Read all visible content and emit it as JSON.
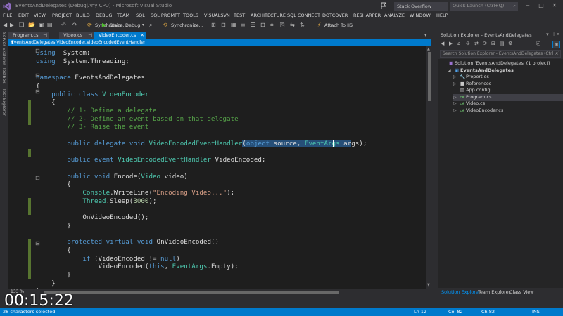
{
  "window": {
    "title": "EventsAndDelegates (Debug|Any CPU) - Microsoft Visual Studio",
    "search_stack_overflow": "Stack Overflow",
    "quick_launch": "Quick Launch (Ctrl+Q)",
    "minimize": "‒",
    "maximize": "□",
    "close": "✕"
  },
  "menu": [
    "FILE",
    "EDIT",
    "VIEW",
    "PROJECT",
    "BUILD",
    "DEBUG",
    "TEAM",
    "SQL",
    "SQL PROMPT",
    "TOOLS",
    "VISUALSVN",
    "TEST",
    "ARCHITECTURE",
    "SQL CONNECT",
    "DOTCOVER",
    "RESHARPER",
    "ANALYZE",
    "WINDOW",
    "HELP"
  ],
  "toolbar": {
    "synchronize": "Synchronize...",
    "start": "Start",
    "config": "Debug",
    "attach": "Attach To IIS"
  },
  "side_tabs": [
    "Server Explorer",
    "Toolbox",
    "Test Explorer"
  ],
  "doc_tabs": [
    {
      "label": "Program.cs",
      "active": false
    },
    {
      "label": "Video.cs",
      "active": false
    },
    {
      "label": "VideoEncoder.cs",
      "active": true
    }
  ],
  "navbar": "EventsAndDelegates.VideoEncoder.VideoEncodedEventHandler",
  "editor": {
    "zoom": "133 %"
  },
  "solution_explorer": {
    "title": "Solution Explorer - EventsAndDelegates",
    "search_placeholder": "Search Solution Explorer - EventsAndDelegates (Ctrl+;)",
    "items": [
      {
        "label": "Solution 'EventsAndDelegates' (1 project)",
        "icon": "solution-icon",
        "level": 0,
        "arrow": ""
      },
      {
        "label": "EventsAndDelegates",
        "icon": "csharp-project-icon",
        "level": 1,
        "arrow": "◢",
        "bold": true
      },
      {
        "label": "Properties",
        "icon": "wrench-icon",
        "level": 2,
        "arrow": "▷"
      },
      {
        "label": "References",
        "icon": "references-icon",
        "level": 2,
        "arrow": "▷"
      },
      {
        "label": "App.config",
        "icon": "config-file-icon",
        "level": 2,
        "arrow": ""
      },
      {
        "label": "Program.cs",
        "icon": "csharp-file-icon",
        "level": 2,
        "arrow": "▷",
        "selected": true
      },
      {
        "label": "Video.cs",
        "icon": "csharp-file-icon",
        "level": 2,
        "arrow": "▷"
      },
      {
        "label": "VideoEncoder.cs",
        "icon": "csharp-file-icon",
        "level": 2,
        "arrow": "▷"
      }
    ],
    "bottom_tabs": [
      {
        "label": "Solution Explorer",
        "active": true
      },
      {
        "label": "Team Explorer",
        "active": false
      },
      {
        "label": "Class View",
        "active": false
      }
    ]
  },
  "status": {
    "selection": "28 characters selected",
    "line": "Ln 12",
    "col": "Col 82",
    "ch": "Ch 82",
    "mode": "INS"
  },
  "timer": "00:15:22",
  "colors": {
    "accent": "#007acc",
    "keyword": "#569cd6",
    "type": "#4ec9b0",
    "comment": "#57a64a",
    "string": "#d69d85",
    "number": "#b5cea8",
    "selection": "#264f78"
  },
  "code": [
    [
      [
        "kw",
        "using"
      ],
      [
        "",
        "  System;"
      ]
    ],
    [
      [
        "kw",
        "using"
      ],
      [
        "",
        "  System.Threading;"
      ]
    ],
    [],
    [
      [
        "kw",
        "namespace"
      ],
      [
        "",
        " EventsAndDelegates"
      ]
    ],
    [
      [
        "",
        "{"
      ]
    ],
    [
      [
        "",
        "    "
      ],
      [
        "kw",
        "public"
      ],
      [
        "",
        " "
      ],
      [
        "kw",
        "class"
      ],
      [
        "",
        " "
      ],
      [
        "ty",
        "VideoEncoder"
      ]
    ],
    [
      [
        "",
        "    {"
      ]
    ],
    [
      [
        "",
        "        "
      ],
      [
        "cm",
        "// 1- Define a delegate"
      ]
    ],
    [
      [
        "",
        "        "
      ],
      [
        "cm",
        "// 2- Define an event based on that delegate"
      ]
    ],
    [
      [
        "",
        "        "
      ],
      [
        "cm",
        "// 3- Raise the event"
      ]
    ],
    [],
    [
      [
        "",
        "        "
      ],
      [
        "kw",
        "public"
      ],
      [
        "",
        " "
      ],
      [
        "kw",
        "delegate"
      ],
      [
        "",
        " "
      ],
      [
        "kw",
        "void"
      ],
      [
        "",
        " "
      ],
      [
        "ty",
        "VideoEncodedEventHandler"
      ],
      [
        "sel",
        "("
      ],
      [
        "sel kw",
        "object"
      ],
      [
        "sel",
        " source, "
      ],
      [
        "sel ty",
        "EventArgs"
      ],
      [
        "sel",
        " ar"
      ],
      [
        "",
        "gs);"
      ]
    ],
    [],
    [
      [
        "",
        "        "
      ],
      [
        "kw",
        "public"
      ],
      [
        "",
        " "
      ],
      [
        "kw",
        "event"
      ],
      [
        "",
        " "
      ],
      [
        "ty",
        "VideoEncodedEventHandler"
      ],
      [
        "",
        " VideoEncoded;"
      ]
    ],
    [],
    [
      [
        "",
        "        "
      ],
      [
        "kw",
        "public"
      ],
      [
        "",
        " "
      ],
      [
        "kw",
        "void"
      ],
      [
        "",
        " Encode("
      ],
      [
        "ty",
        "Video"
      ],
      [
        "",
        " video)"
      ]
    ],
    [
      [
        "",
        "        {"
      ]
    ],
    [
      [
        "",
        "            "
      ],
      [
        "ty",
        "Console"
      ],
      [
        "",
        ".WriteLine("
      ],
      [
        "st",
        "\"Encoding Video...\""
      ],
      [
        "",
        ");"
      ]
    ],
    [
      [
        "",
        "            "
      ],
      [
        "ty",
        "Thread"
      ],
      [
        "",
        ".Sleep("
      ],
      [
        "nm",
        "3000"
      ],
      [
        "",
        ");"
      ]
    ],
    [],
    [
      [
        "",
        "            OnVideoEncoded();"
      ]
    ],
    [
      [
        "",
        "        }"
      ]
    ],
    [],
    [
      [
        "",
        "        "
      ],
      [
        "kw",
        "protected"
      ],
      [
        "",
        " "
      ],
      [
        "kw",
        "virtual"
      ],
      [
        "",
        " "
      ],
      [
        "kw",
        "void"
      ],
      [
        "",
        " OnVideoEncoded()"
      ]
    ],
    [
      [
        "",
        "        {"
      ]
    ],
    [
      [
        "",
        "            "
      ],
      [
        "kw",
        "if"
      ],
      [
        "",
        " (VideoEncoded != "
      ],
      [
        "kw",
        "null"
      ],
      [
        "",
        ")"
      ]
    ],
    [
      [
        "",
        "                VideoEncoded("
      ],
      [
        "kw",
        "this"
      ],
      [
        "",
        ", "
      ],
      [
        "ty",
        "EventArgs"
      ],
      [
        "",
        ".Empty);"
      ]
    ],
    [
      [
        "",
        "        }"
      ]
    ],
    [
      [
        "",
        "    }"
      ]
    ],
    [
      [
        "",
        "}"
      ]
    ]
  ]
}
